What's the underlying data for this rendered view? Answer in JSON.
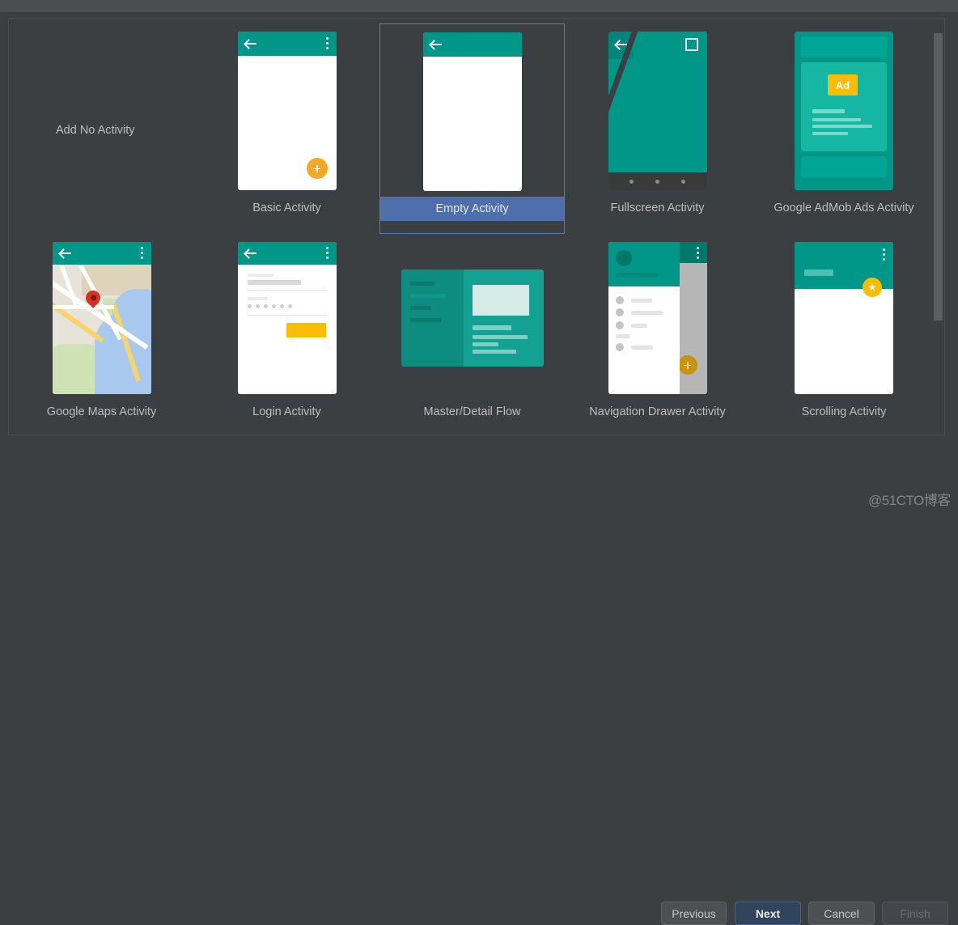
{
  "dialog": {
    "title_bar_color": "#4b4e50",
    "background_color": "#3c3f41",
    "accent_color": "#4e6fab"
  },
  "gallery": {
    "no_activity_label": "Add No Activity",
    "selected_index": 1,
    "items": [
      {
        "label": "Basic Activity",
        "icon": "basic-activity-thumbnail"
      },
      {
        "label": "Empty Activity",
        "icon": "empty-activity-thumbnail"
      },
      {
        "label": "Fullscreen Activity",
        "icon": "fullscreen-activity-thumbnail"
      },
      {
        "label": "Google AdMob Ads Activity",
        "icon": "admob-activity-thumbnail"
      },
      {
        "label": "Google Maps Activity",
        "icon": "maps-activity-thumbnail"
      },
      {
        "label": "Login Activity",
        "icon": "login-activity-thumbnail"
      },
      {
        "label": "Master/Detail Flow",
        "icon": "master-detail-thumbnail"
      },
      {
        "label": "Navigation Drawer Activity",
        "icon": "nav-drawer-thumbnail"
      },
      {
        "label": "Scrolling Activity",
        "icon": "scrolling-activity-thumbnail"
      }
    ],
    "admob_badge": "Ad"
  },
  "footer": {
    "previous_label": "Previous",
    "next_label": "Next",
    "cancel_label": "Cancel",
    "finish_label": "Finish"
  },
  "watermark": {
    "text": "@51CTO博客"
  }
}
